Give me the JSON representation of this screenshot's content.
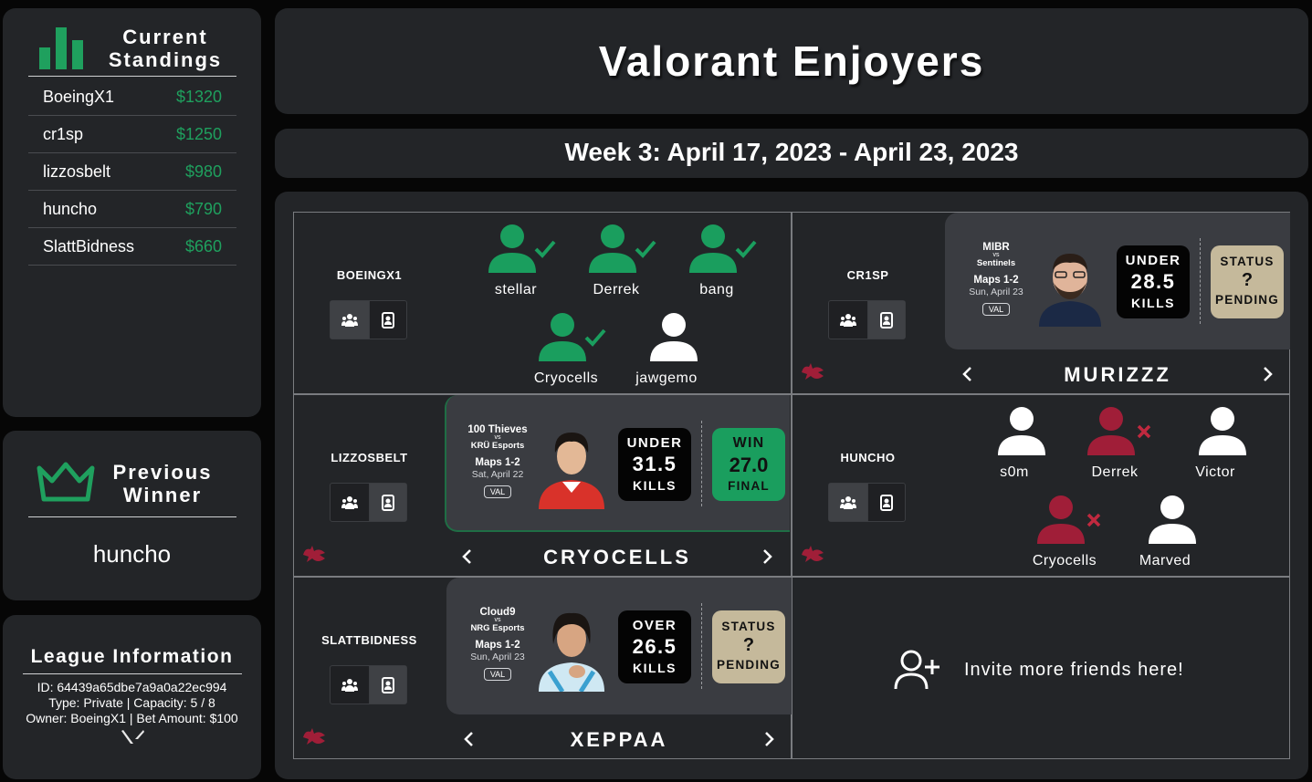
{
  "colors": {
    "accent_green": "#1fa05e",
    "loss_red": "#a01e38",
    "pending_tan": "#c5b99b",
    "win_green": "#1a9e5e",
    "panel": "#232528"
  },
  "standings": {
    "title_line1": "Current",
    "title_line2": "Standings",
    "icon": "bar-chart-icon",
    "rows": [
      {
        "name": "BoeingX1",
        "amount": "$1320"
      },
      {
        "name": "cr1sp",
        "amount": "$1250"
      },
      {
        "name": "lizzosbelt",
        "amount": "$980"
      },
      {
        "name": "huncho",
        "amount": "$790"
      },
      {
        "name": "SlattBidness",
        "amount": "$660"
      }
    ]
  },
  "previous_winner": {
    "title_line1": "Previous",
    "title_line2": "Winner",
    "icon": "crown-icon",
    "name": "huncho"
  },
  "league_info": {
    "title": "League Information",
    "id_line": "ID: 64439a65dbe7a9a0a22ec994",
    "type_line": "Type: Private | Capacity: 5 / 8",
    "owner_line": "Owner: BoeingX1 | Bet Amount: $100",
    "icon": "valorant-logo-icon"
  },
  "header": {
    "title": "Valorant Enjoyers",
    "week": "Week 3: April 17, 2023 - April 23, 2023"
  },
  "players": [
    {
      "name": "BOEINGX1",
      "view": "team",
      "picks": [
        {
          "name": "stellar",
          "state": "win"
        },
        {
          "name": "Derrek",
          "state": "win"
        },
        {
          "name": "bang",
          "state": "win"
        },
        {
          "name": "Cryocells",
          "state": "win"
        },
        {
          "name": "jawgemo",
          "state": "none"
        }
      ]
    },
    {
      "name": "CR1SP",
      "view": "bet",
      "bet": {
        "team1": "MIBR",
        "vs": "vs",
        "team2": "Sentinels",
        "maps": "Maps 1-2",
        "date": "Sun, April 23",
        "game": "VAL",
        "line_type": "UNDER",
        "line_value": "28.5",
        "line_unit": "KILLS",
        "status_top": "STATUS",
        "status_mid": "?",
        "status_bottom": "PENDING",
        "player": "MURIZZZ"
      }
    },
    {
      "name": "LIZZOSBELT",
      "view": "bet",
      "bet": {
        "team1": "100 Thieves",
        "vs": "vs",
        "team2": "KRÜ Esports",
        "maps": "Maps 1-2",
        "date": "Sat, April 22",
        "game": "VAL",
        "line_type": "UNDER",
        "line_value": "31.5",
        "line_unit": "KILLS",
        "status_top": "WIN",
        "status_mid": "27.0",
        "status_bottom": "FINAL",
        "player": "CRYOCELLS"
      }
    },
    {
      "name": "HUNCHO",
      "view": "team",
      "picks": [
        {
          "name": "s0m",
          "state": "none"
        },
        {
          "name": "Derrek",
          "state": "loss"
        },
        {
          "name": "Victor",
          "state": "none"
        },
        {
          "name": "Cryocells",
          "state": "loss"
        },
        {
          "name": "Marved",
          "state": "none"
        }
      ]
    },
    {
      "name": "SLATTBIDNESS",
      "view": "bet",
      "bet": {
        "team1": "Cloud9",
        "vs": "vs",
        "team2": "NRG Esports",
        "maps": "Maps 1-2",
        "date": "Sun, April 23",
        "game": "VAL",
        "line_type": "OVER",
        "line_value": "26.5",
        "line_unit": "KILLS",
        "status_top": "STATUS",
        "status_mid": "?",
        "status_bottom": "PENDING",
        "player": "XEPPAA"
      }
    }
  ],
  "invite": {
    "text": "Invite more friends here!",
    "icon": "add-user-icon"
  }
}
